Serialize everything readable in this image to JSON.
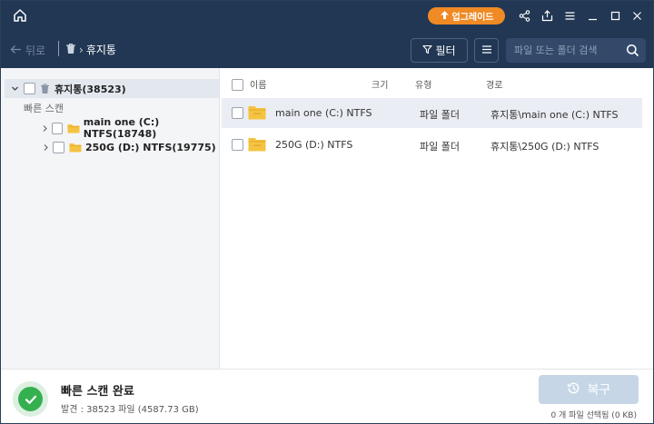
{
  "header": {
    "upgrade_label": "업그레이드",
    "back_label": "뒤로",
    "breadcrumb": "휴지통",
    "filter_label": "필터",
    "search_placeholder": "파일 또는 폴더 검색"
  },
  "icons": {
    "home": "home-icon",
    "share": "share-icon",
    "export": "export-icon",
    "menu": "hamburger-icon",
    "minimize": "minimize-icon",
    "maximize": "maximize-icon",
    "close": "close-icon",
    "search": "search-icon",
    "trash": "trash-icon",
    "folder": "folder-icon",
    "history": "history-icon",
    "check": "check-icon"
  },
  "sidebar": {
    "root_label": "휴지통(38523)",
    "section_label": "빠른 스캔",
    "items": [
      {
        "label": "main one (C:) NTFS(18748)"
      },
      {
        "label": "250G (D:) NTFS(19775)"
      }
    ]
  },
  "table": {
    "columns": {
      "name": "이름",
      "size": "크기",
      "type": "유형",
      "path": "경로"
    },
    "rows": [
      {
        "name": "main one (C:) NTFS",
        "size": "",
        "type": "파일 폴더",
        "path": "휴지통\\main one (C:) NTFS"
      },
      {
        "name": "250G (D:) NTFS",
        "size": "",
        "type": "파일 폴더",
        "path": "휴지통\\250G (D:) NTFS"
      }
    ]
  },
  "footer": {
    "title": "빠른 스캔 완료",
    "subtitle": "발견 : 38523 파일 (4587.73 GB)",
    "recover_label": "복구",
    "selection_status": "0 개 파일 선택됨 (0 KB)"
  },
  "colors": {
    "header_bg": "#223754",
    "accent_orange": "#ef8a24",
    "folder_yellow": "#f5c342",
    "success_green": "#35b04f",
    "disabled_button": "#c6d6e6"
  }
}
